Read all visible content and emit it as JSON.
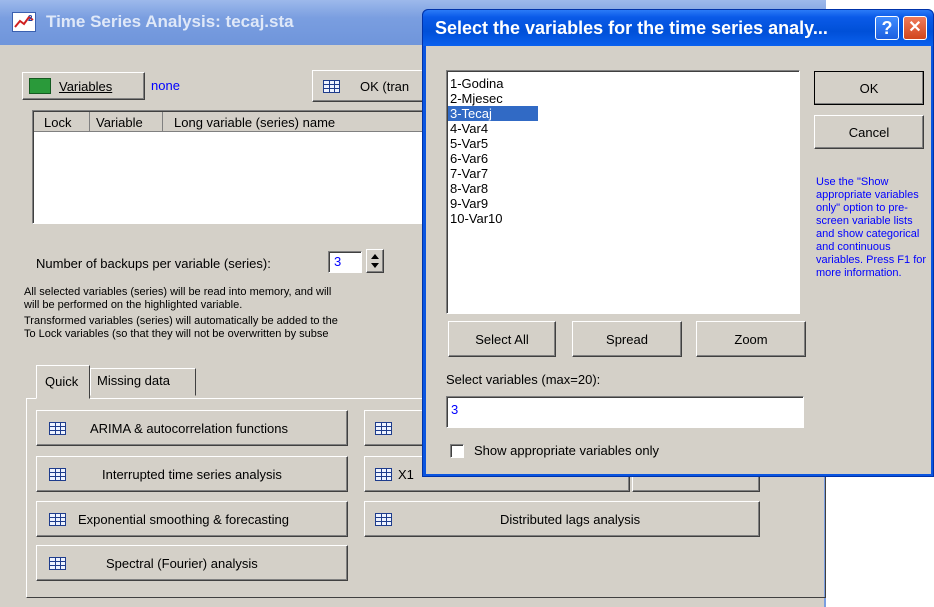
{
  "main_window": {
    "title": "Time Series Analysis: tecaj.sta",
    "variables_button": "Variables",
    "variables_value": "none",
    "ok_button": "OK (tran",
    "table_headers": [
      "Lock",
      "Variable",
      "Long variable (series) name"
    ],
    "backups_label": "Number of backups per variable (series):",
    "backups_value": "3",
    "info_lines": [
      "All selected variables (series) will be read into memory, and will",
      "will be performed on the highlighted variable.",
      "Transformed variables (series) will automatically be added to the",
      "To Lock variables (so that they will not be overwritten by subse"
    ],
    "tabs": [
      "Quick",
      "Missing data"
    ],
    "analysis_buttons": {
      "arima": "ARIMA & autocorrelation functions",
      "interrupted": "Interrupted time series analysis",
      "exponential": "Exponential smoothing & forecasting",
      "spectral": "Spectral (Fourier) analysis",
      "x11": "X1",
      "distributed": "Distributed lags analysis"
    }
  },
  "dialog": {
    "title": "Select the variables for the time series analy...",
    "help_button": "?",
    "close_button": "✕",
    "variables": [
      "1-Godina",
      "2-Mjesec",
      "3-Tecaj",
      "4-Var4",
      "5-Var5",
      "6-Var6",
      "7-Var7",
      "8-Var8",
      "9-Var9",
      "10-Var10"
    ],
    "selected_variable": "3-Tecaj",
    "ok_button": "OK",
    "cancel_button": "Cancel",
    "help_text": "Use the \"Show appropriate variables only\" option to pre-screen variable lists and show categorical and continuous variables. Press F1 for more information.",
    "select_all_button": "Select All",
    "spread_button": "Spread",
    "zoom_button": "Zoom",
    "select_label": "Select variables (max=20):",
    "select_value": "3",
    "checkbox_label": "Show appropriate variables only",
    "checkbox_checked": false
  }
}
